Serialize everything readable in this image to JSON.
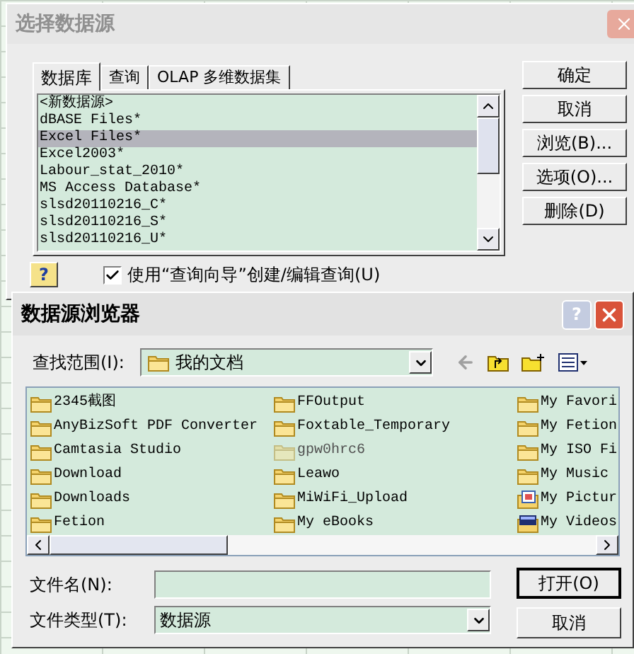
{
  "dialog": {
    "title": "选择数据源",
    "tabs": [
      {
        "label": "数据库",
        "selected": true
      },
      {
        "label": "查询",
        "selected": false
      },
      {
        "label": "OLAP 多维数据集",
        "selected": false
      }
    ],
    "sources": [
      {
        "label": "<新数据源>",
        "selected": false
      },
      {
        "label": "dBASE Files*",
        "selected": false
      },
      {
        "label": "Excel Files*",
        "selected": true
      },
      {
        "label": "Excel2003*",
        "selected": false
      },
      {
        "label": "Labour_stat_2010*",
        "selected": false
      },
      {
        "label": "MS Access Database*",
        "selected": false
      },
      {
        "label": "slsd20110216_C*",
        "selected": false
      },
      {
        "label": "slsd20110216_S*",
        "selected": false
      },
      {
        "label": "slsd20110216_U*",
        "selected": false
      }
    ],
    "buttons": [
      "确定",
      "取消",
      "浏览(B)...",
      "选项(O)...",
      "删除(D)"
    ],
    "help_button": "?",
    "wizard": {
      "label": "使用“查询向导”创建/编辑查询(U)",
      "checked": true
    }
  },
  "browser": {
    "title": "数据源浏览器",
    "help_button": "?",
    "look_in": {
      "label": "查找范围(I):",
      "value": "我的文档"
    },
    "files": [
      {
        "name": "2345截图",
        "kind": "folder",
        "hidden": false
      },
      {
        "name": "AnyBizSoft PDF Converter",
        "kind": "folder",
        "hidden": false
      },
      {
        "name": "Camtasia Studio",
        "kind": "folder",
        "hidden": false
      },
      {
        "name": "Download",
        "kind": "folder",
        "hidden": false
      },
      {
        "name": "Downloads",
        "kind": "folder",
        "hidden": false
      },
      {
        "name": "Fetion",
        "kind": "folder",
        "hidden": false
      },
      {
        "name": "FFOutput",
        "kind": "folder",
        "hidden": false
      },
      {
        "name": "Foxtable_Temporary",
        "kind": "folder",
        "hidden": false
      },
      {
        "name": "gpw0hrc6",
        "kind": "folder",
        "hidden": true
      },
      {
        "name": "Leawo",
        "kind": "folder",
        "hidden": false
      },
      {
        "name": "MiWiFi_Upload",
        "kind": "folder",
        "hidden": false
      },
      {
        "name": "My eBooks",
        "kind": "folder",
        "hidden": false
      },
      {
        "name": "My Favori",
        "kind": "folder",
        "hidden": false
      },
      {
        "name": "My Fetion",
        "kind": "folder",
        "hidden": false
      },
      {
        "name": "My ISO Fi",
        "kind": "folder",
        "hidden": false
      },
      {
        "name": "My Music",
        "kind": "folder",
        "hidden": false
      },
      {
        "name": "My Pictur",
        "kind": "pictures",
        "hidden": false
      },
      {
        "name": "My Videos",
        "kind": "videos",
        "hidden": false
      }
    ],
    "file_name": {
      "label": "文件名(N):"
    },
    "file_type": {
      "label": "文件类型(T):",
      "value": "数据源"
    },
    "buttons": [
      "打开(O)",
      "取消"
    ]
  }
}
